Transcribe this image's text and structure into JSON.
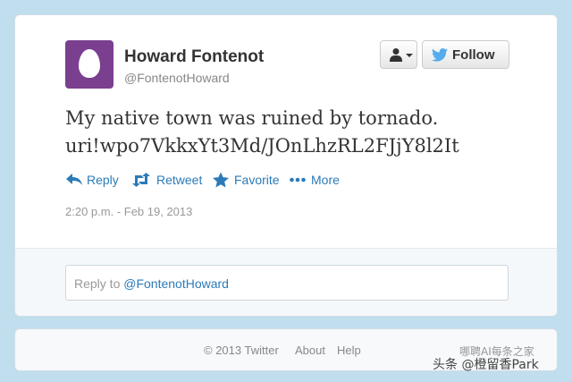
{
  "user": {
    "display_name": "Howard Fontenot",
    "screen_name": "@FontenotHoward"
  },
  "buttons": {
    "follow_label": "Follow"
  },
  "tweet": {
    "text_line1": "My native town was ruined by tornado.",
    "text_line2": "uri!wpo7VkkxYt3Md/JOnLhzRL2FJjY8l2It",
    "timestamp": "2:20 p.m. - Feb 19, 2013"
  },
  "actions": {
    "reply": "Reply",
    "retweet": "Retweet",
    "favorite": "Favorite",
    "more": "More"
  },
  "reply_box": {
    "prefix": "Reply to ",
    "mention": "@FontenotHoward"
  },
  "footer": {
    "copyright": "© 2013 Twitter",
    "about": "About",
    "help": "Help"
  },
  "watermark": {
    "line1": "哪聘AI每条之家",
    "line2": "头条 @橙留香Park"
  },
  "colors": {
    "background": "#c0deed",
    "link": "#2b7bb9",
    "avatar": "#7b3f8f",
    "twitter_bird": "#55acee"
  },
  "icons": {
    "avatar": "egg-avatar",
    "user_menu": "person-icon",
    "follow": "twitter-bird-icon",
    "reply": "reply-arrow-icon",
    "retweet": "retweet-icon",
    "favorite": "star-icon",
    "more": "ellipsis-icon"
  }
}
